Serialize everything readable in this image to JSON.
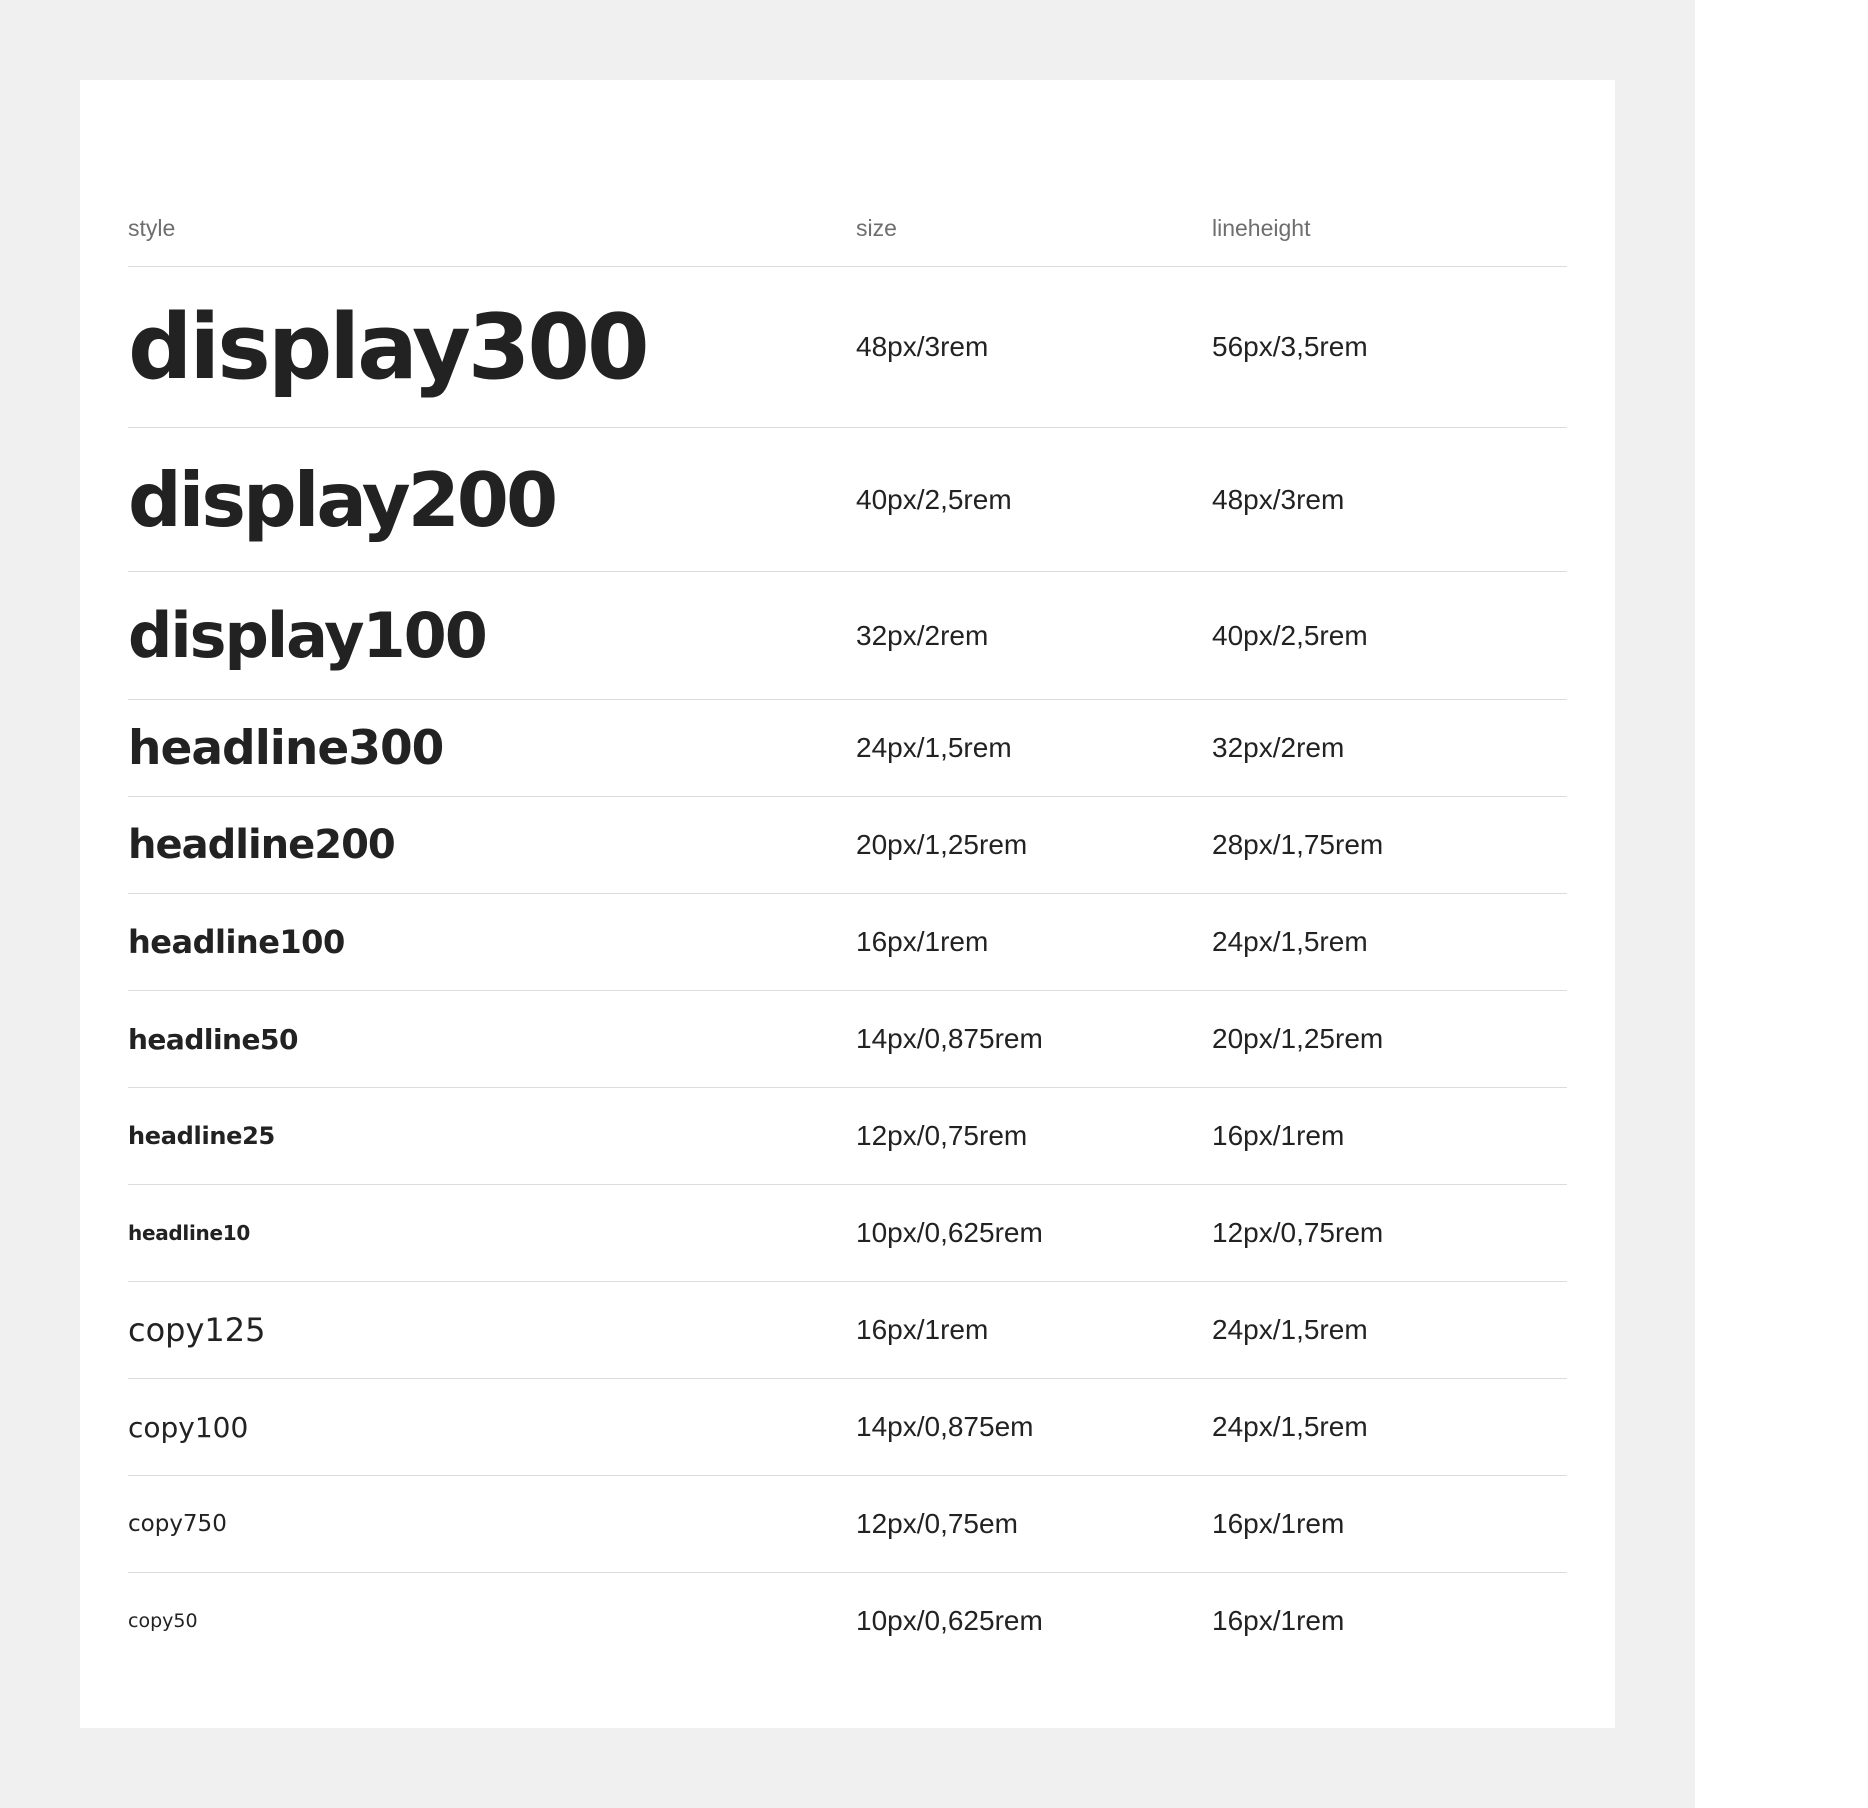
{
  "columns": {
    "style": "style",
    "size": "size",
    "lineheight": "lineheight"
  },
  "rows": [
    {
      "style": "display300",
      "size": "48px/3rem",
      "lineheight": "56px/3,5rem"
    },
    {
      "style": "display200",
      "size": "40px/2,5rem",
      "lineheight": "48px/3rem"
    },
    {
      "style": "display100",
      "size": "32px/2rem",
      "lineheight": "40px/2,5rem"
    },
    {
      "style": "headline300",
      "size": "24px/1,5rem",
      "lineheight": "32px/2rem"
    },
    {
      "style": "headline200",
      "size": "20px/1,25rem",
      "lineheight": "28px/1,75rem"
    },
    {
      "style": "headline100",
      "size": "16px/1rem",
      "lineheight": "24px/1,5rem"
    },
    {
      "style": "headline50",
      "size": "14px/0,875rem",
      "lineheight": "20px/1,25rem"
    },
    {
      "style": "headline25",
      "size": "12px/0,75rem",
      "lineheight": "16px/1rem"
    },
    {
      "style": "headline10",
      "size": "10px/0,625rem",
      "lineheight": "12px/0,75rem"
    },
    {
      "style": "copy125",
      "size": "16px/1rem",
      "lineheight": "24px/1,5rem"
    },
    {
      "style": "copy100",
      "size": "14px/0,875em",
      "lineheight": "24px/1,5rem"
    },
    {
      "style": "copy750",
      "size": "12px/0,75em",
      "lineheight": "16px/1rem"
    },
    {
      "style": "copy50",
      "size": "10px/0,625rem",
      "lineheight": "16px/1rem"
    }
  ]
}
